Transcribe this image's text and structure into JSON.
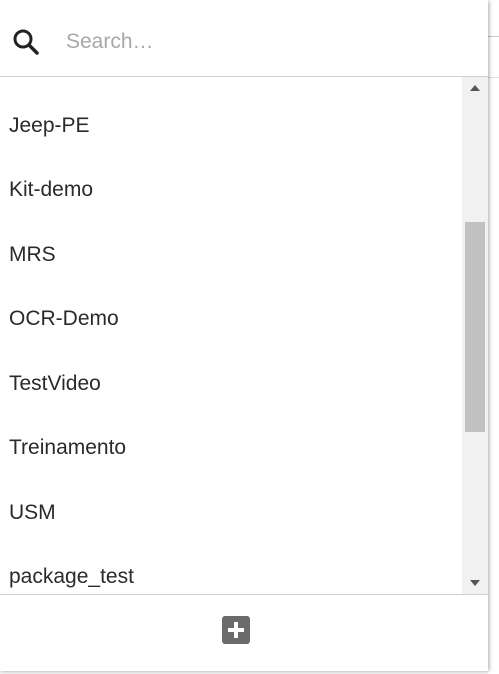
{
  "search": {
    "placeholder": "Search…",
    "value": ""
  },
  "list": {
    "items": [
      {
        "label": "Jeep-PE"
      },
      {
        "label": "Kit-demo"
      },
      {
        "label": "MRS"
      },
      {
        "label": "OCR-Demo"
      },
      {
        "label": "TestVideo"
      },
      {
        "label": "Treinamento"
      },
      {
        "label": "USM"
      },
      {
        "label": "package_test"
      }
    ]
  },
  "icons": {
    "search": "search-icon",
    "add": "add-icon",
    "scroll_up": "chevron-up-icon",
    "scroll_down": "chevron-down-icon"
  },
  "colors": {
    "panel_bg": "#ffffff",
    "text": "#2a2a2a",
    "placeholder": "#a8a8a8",
    "scroll_thumb": "#c1c1c1",
    "add_button": "#6b6b6b"
  }
}
